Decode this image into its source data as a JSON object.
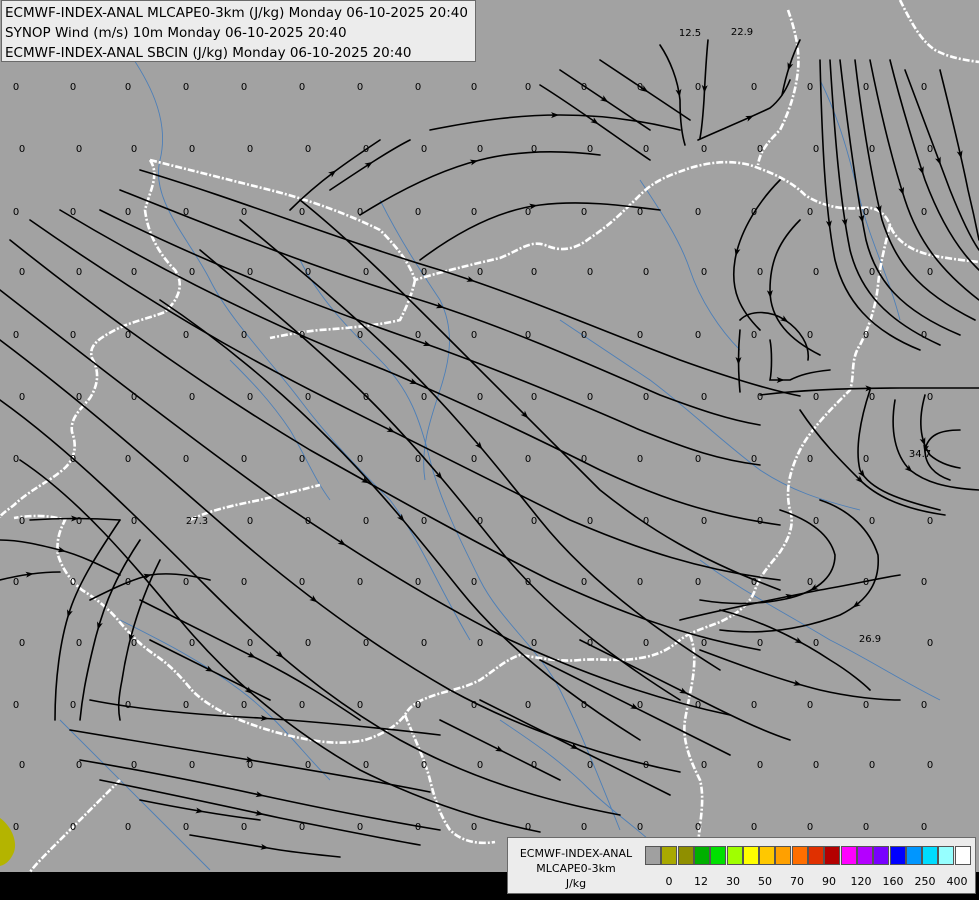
{
  "header": {
    "line1": "ECMWF-INDEX-ANAL MLCAPE0-3km (J/kg) Monday 06-10-2025 20:40",
    "line2": "SYNOP Wind (m/s) 10m Monday 06-10-2025 20:40",
    "line3": "ECMWF-INDEX-ANAL SBCIN (J/kg) Monday 06-10-2025 20:40"
  },
  "legend": {
    "title1": "ECMWF-INDEX-ANAL",
    "title2": "MLCAPE0-3km",
    "unit": "J/kg",
    "ticks": [
      "0",
      "12",
      "30",
      "50",
      "70",
      "90",
      "120",
      "160",
      "250",
      "400"
    ],
    "colors": [
      "#a0a0a0",
      "#a9a901",
      "#8f8f00",
      "#00b000",
      "#00e000",
      "#a0ff00",
      "#ffff00",
      "#ffc800",
      "#ffa000",
      "#ff6e00",
      "#e03000",
      "#b40000",
      "#ff00ff",
      "#b400ff",
      "#7800ff",
      "#0000ff",
      "#0096ff",
      "#00dcff",
      "#96ffff",
      "#ffffff"
    ]
  },
  "labels": {
    "special": [
      "12.5",
      "22.9",
      "27.3",
      "34.7",
      "26.9"
    ],
    "zero": "0"
  },
  "colors": {
    "background": "#a2a2a2",
    "streamline": "#000000",
    "border": "#ffffff",
    "river": "#4d7fb8",
    "cape_blob": "#b4b400"
  }
}
